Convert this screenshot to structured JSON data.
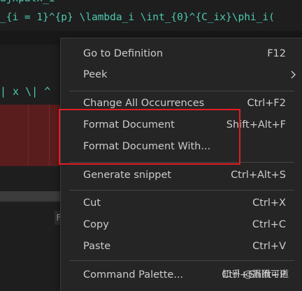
{
  "editor": {
    "code_top": "_{i = 1}^{p} \\lambda_i \\int_{0}^{C_ix}\\phi_i(",
    "code_fragment_top": "ajxpalx_i",
    "tab_fragment": "| x \\| ^",
    "side_fragment": "F"
  },
  "context_menu": {
    "items": [
      {
        "label": "Go to Definition",
        "key": "F12"
      },
      {
        "label": "Peek",
        "key": ""
      },
      {
        "label": "Change All Occurrences",
        "key": "Ctrl+F2"
      },
      {
        "label": "Format Document",
        "key": "Shift+Alt+F"
      },
      {
        "label": "Format Document With...",
        "key": ""
      },
      {
        "label": "Generate snippet",
        "key": "Ctrl+Alt+S"
      },
      {
        "label": "Cut",
        "key": "Ctrl+X"
      },
      {
        "label": "Copy",
        "key": "Ctrl+C"
      },
      {
        "label": "Paste",
        "key": "Ctrl+V"
      },
      {
        "label": "Command Palette...",
        "key": "Ctrl+Shift+P"
      }
    ]
  },
  "watermark": "知乎 @猫猫可道",
  "colors": {
    "menu_bg": "#252526",
    "menu_text": "#cccccc",
    "highlight_border": "#e51c23",
    "code_text": "#4ec9b0"
  }
}
